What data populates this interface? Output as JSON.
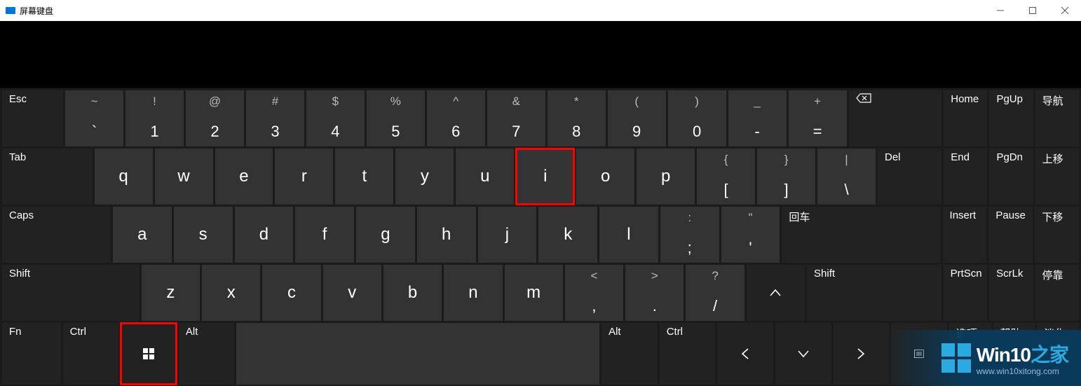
{
  "window": {
    "title": "屏幕键盘"
  },
  "row1": {
    "esc": "Esc",
    "keys": [
      {
        "s": "~",
        "m": "`"
      },
      {
        "s": "!",
        "m": "1"
      },
      {
        "s": "@",
        "m": "2"
      },
      {
        "s": "#",
        "m": "3"
      },
      {
        "s": "$",
        "m": "4"
      },
      {
        "s": "%",
        "m": "5"
      },
      {
        "s": "^",
        "m": "6"
      },
      {
        "s": "&",
        "m": "7"
      },
      {
        "s": "*",
        "m": "8"
      },
      {
        "s": "(",
        "m": "9"
      },
      {
        "s": ")",
        "m": "0"
      },
      {
        "s": "_",
        "m": "-"
      },
      {
        "s": "+",
        "m": "="
      }
    ],
    "nav": [
      "Home",
      "PgUp",
      "导航"
    ]
  },
  "row2": {
    "tab": "Tab",
    "keys": [
      "q",
      "w",
      "e",
      "r",
      "t",
      "y",
      "u",
      "i",
      "o",
      "p"
    ],
    "brackets": [
      {
        "s": "{",
        "m": "["
      },
      {
        "s": "}",
        "m": "]"
      },
      {
        "s": "|",
        "m": "\\"
      }
    ],
    "del": "Del",
    "nav": [
      "End",
      "PgDn",
      "上移"
    ]
  },
  "row3": {
    "caps": "Caps",
    "keys": [
      "a",
      "s",
      "d",
      "f",
      "g",
      "h",
      "j",
      "k",
      "l"
    ],
    "punct": [
      {
        "s": ":",
        "m": ";"
      },
      {
        "s": "\"",
        "m": "'"
      }
    ],
    "enter": "回车",
    "nav": [
      "Insert",
      "Pause",
      "下移"
    ]
  },
  "row4": {
    "shiftL": "Shift",
    "keys": [
      "z",
      "x",
      "c",
      "v",
      "b",
      "n",
      "m"
    ],
    "punct": [
      {
        "s": "<",
        "m": ","
      },
      {
        "s": ">",
        "m": "."
      },
      {
        "s": "?",
        "m": "/"
      }
    ],
    "shiftR": "Shift",
    "nav": [
      "PrtScn",
      "ScrLk",
      "停靠"
    ]
  },
  "row5": {
    "fn": "Fn",
    "ctrlL": "Ctrl",
    "altL": "Alt",
    "altR": "Alt",
    "ctrlR": "Ctrl",
    "nav": [
      "选项",
      "帮助",
      "淡化"
    ]
  },
  "watermark": {
    "main": "Win10",
    "em": "之家",
    "url": "www.win10xitong.com"
  }
}
